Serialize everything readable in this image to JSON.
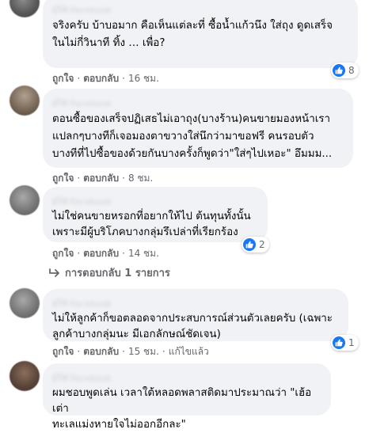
{
  "comments": [
    {
      "author": "ผู้ใช้ Facebook",
      "text": "จริงครับ บ้าบอมาก คือเห็นแต่ละที่ ซื้อน้ำแก้วนึง ใส่ถุง ดูดเสร็จ\nในไม่กี่วินาที ทิ้ง … เพื่อ?",
      "like_label": "ถูกใจ",
      "reply_label": "ตอบกลับ",
      "time": "16 ชม.",
      "reaction_count": "8"
    },
    {
      "author": "ผู้ใช้ Facebook",
      "text": "ตอนซื้อของเสร็จปฏิเสธไม่เอาถุง(บางร้าน)คนขายมองหน้าเรา\nแปลกๆบางทีก็เจอมองตาขวางใส่นึกว่ามาขอฟรี คนรอบตัว\nบางทีที่ไปซื้อของด้วยกันบางครั้งก็พูดว่า\"ใส่ๆไปเหอะ\" อึมมม...",
      "like_label": "ถูกใจ",
      "reply_label": "ตอบกลับ",
      "time": "8 ชม."
    },
    {
      "author": "ผู้ใช้ Facebook",
      "text": "ไม่ใช่คนขายหรอกที่อยากให้ไป ต้นทุนทั้งนั้น\nเพราะมีผู้บริโภคบางกลุ่มรึเปล่าที่เรียกร้อง",
      "like_label": "ถูกใจ",
      "reply_label": "ตอบกลับ",
      "time": "14 ชม.",
      "reaction_count": "2",
      "replies_label": "การตอบกลับ 1 รายการ"
    },
    {
      "author": "ผู้ใช้ Facebook",
      "text": "ไม่ให้ลูกค้าก็ขอตลอดจากประสบการณ์ส่วนตัวเลยครับ (เฉพาะ\nลูกค้าบางกลุ่มนะ มีเอกลักษณ์ชัดเจน)",
      "like_label": "ถูกใจ",
      "reply_label": "ตอบกลับ",
      "time": "15 ชม.",
      "edited_label": "แก้ไขแล้ว",
      "reaction_count": "1"
    },
    {
      "author": "ผู้ใช้ Facebook",
      "text": "ผมชอบพูดเล่น เวลาใต้หลอดพลาสติดมาประมาณว่า \"เฮ้อ เต่า\nทะเลแม่งหายใจไม่ออกอีกละ\""
    }
  ],
  "colors": {
    "bubble": "#f0f2f5",
    "meta_text": "#65676b",
    "like_blue": "#1877f2"
  },
  "icons": {
    "like": "thumbs-up-icon",
    "reply_arrow": "reply-arrow-icon"
  }
}
